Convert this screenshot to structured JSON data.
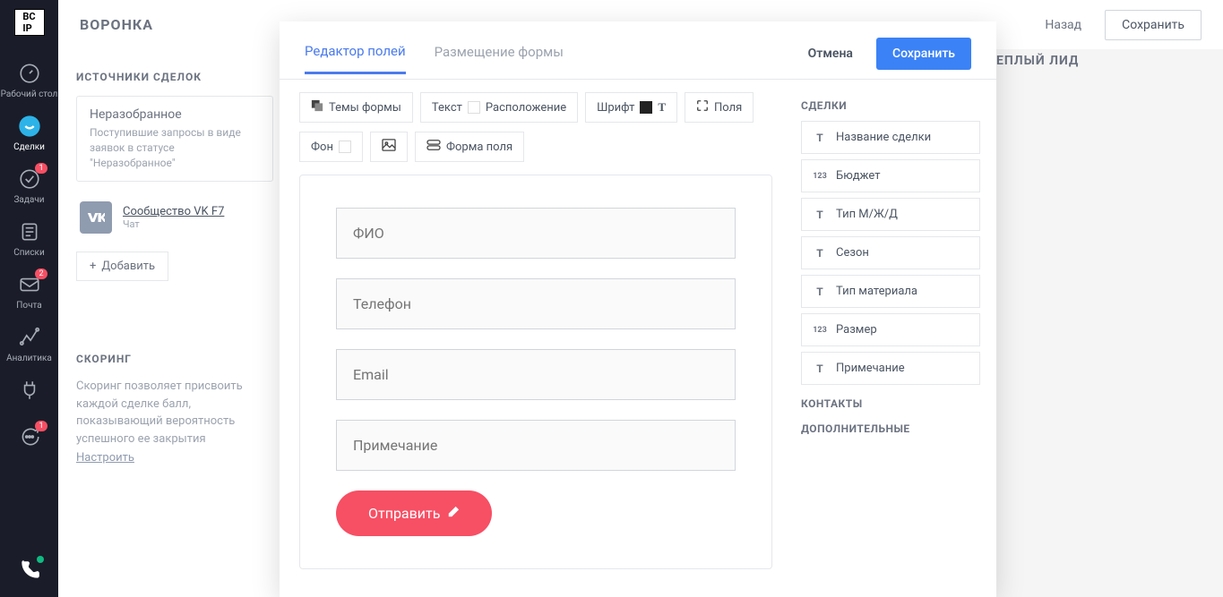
{
  "app": {
    "logo_text": "BC\nIP",
    "page_title": "ВОРОНКА"
  },
  "sidebar": {
    "items": [
      {
        "label": "Рабочий стол",
        "icon": "dashboard"
      },
      {
        "label": "Сделки",
        "icon": "deals",
        "active": true
      },
      {
        "label": "Задачи",
        "icon": "tasks",
        "badge": "1"
      },
      {
        "label": "Списки",
        "icon": "lists"
      },
      {
        "label": "Почта",
        "icon": "mail",
        "badge": "2"
      },
      {
        "label": "Аналитика",
        "icon": "analytics"
      }
    ]
  },
  "topbar": {
    "back": "Назад",
    "save": "Сохранить"
  },
  "leftpanel": {
    "sources_heading": "ИСТОЧНИКИ СДЕЛОК",
    "unsorted": {
      "title": "Неразобранное",
      "desc": "Поступившие запросы в виде заявок в статусе \"Неразобранное\""
    },
    "vk": {
      "name": "Сообщество VK F7",
      "type": "Чат"
    },
    "add": "Добавить",
    "scoring": {
      "heading": "СКОРИНГ",
      "text": "Скоринг позволяет присвоить каждой сделке балл, показывающий вероятность успешного ее закрытия",
      "link": "Настроить"
    }
  },
  "stage": {
    "label": "ЕПЛЫЙ ЛИД"
  },
  "modal": {
    "tabs": {
      "editor": "Редактор полей",
      "placement": "Размещение формы"
    },
    "cancel": "Отмена",
    "save": "Сохранить",
    "toolbar": {
      "themes": "Темы формы",
      "text": "Текст",
      "layout": "Расположение",
      "font": "Шрифт",
      "fields": "Поля",
      "bg": "Фон",
      "fieldshape": "Форма поля"
    },
    "form": {
      "fio": "ФИО",
      "phone": "Телефон",
      "email": "Email",
      "note": "Примечание",
      "submit": "Отправить"
    },
    "field_groups": {
      "deals": "СДЕЛКИ",
      "contacts": "КОНТАКТЫ",
      "additional": "ДОПОЛНИТЕЛЬНЫЕ"
    },
    "deal_fields": [
      {
        "icon": "T",
        "label": "Название сделки"
      },
      {
        "icon": "123",
        "label": "Бюджет"
      },
      {
        "icon": "T",
        "label": "Тип М/Ж/Д"
      },
      {
        "icon": "T",
        "label": "Сезон"
      },
      {
        "icon": "T",
        "label": "Тип материала"
      },
      {
        "icon": "123",
        "label": "Размер"
      },
      {
        "icon": "T",
        "label": "Примечание"
      }
    ]
  }
}
